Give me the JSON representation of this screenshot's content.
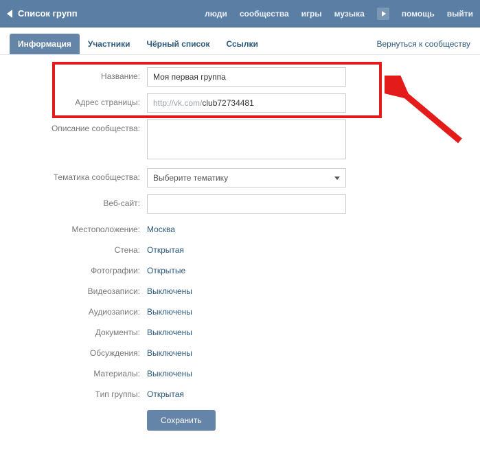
{
  "topbar": {
    "title": "Список групп",
    "nav": {
      "people": "люди",
      "communities": "сообщества",
      "games": "игры",
      "music": "музыка",
      "help": "помощь",
      "logout": "выйти"
    }
  },
  "tabs": {
    "info": "Информация",
    "members": "Участники",
    "blacklist": "Чёрный список",
    "links": "Ссылки",
    "return": "Вернуться к сообществу"
  },
  "form": {
    "name_label": "Название:",
    "name_value": "Моя первая группа",
    "address_label": "Адрес страницы:",
    "address_prefix": "http://vk.com/",
    "address_value": "club72734481",
    "description_label": "Описание сообщества:",
    "description_value": "",
    "topic_label": "Тематика сообщества:",
    "topic_placeholder": "Выберите тематику",
    "website_label": "Веб-сайт:",
    "website_value": "",
    "location_label": "Местоположение:",
    "location_value": "Москва",
    "wall_label": "Стена:",
    "wall_value": "Открытая",
    "photos_label": "Фотографии:",
    "photos_value": "Открытые",
    "videos_label": "Видеозаписи:",
    "videos_value": "Выключены",
    "audios_label": "Аудиозаписи:",
    "audios_value": "Выключены",
    "docs_label": "Документы:",
    "docs_value": "Выключены",
    "discussions_label": "Обсуждения:",
    "discussions_value": "Выключены",
    "materials_label": "Материалы:",
    "materials_value": "Выключены",
    "group_type_label": "Тип группы:",
    "group_type_value": "Открытая",
    "save_button": "Сохранить"
  },
  "colors": {
    "accent": "#5b7ea4",
    "link": "#2b587a",
    "highlight": "#e41b1b"
  }
}
